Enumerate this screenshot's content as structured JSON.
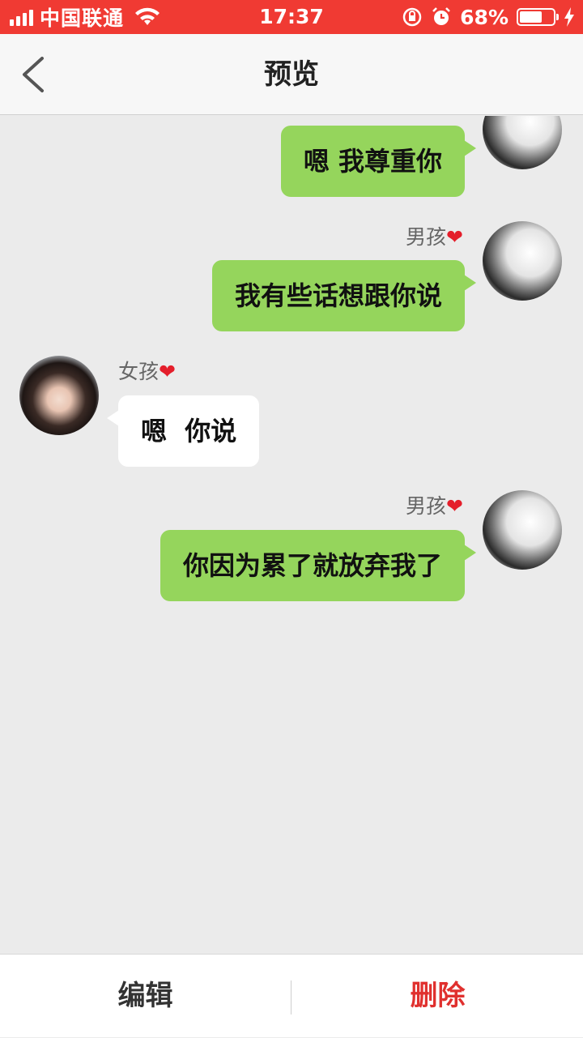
{
  "status_bar": {
    "carrier": "中国联通",
    "time": "17:37",
    "battery_percent": "68%",
    "battery_level": 0.68,
    "icons": [
      "signal-icon",
      "wifi-icon",
      "rotation-lock-icon",
      "alarm-icon",
      "battery-icon",
      "charging-icon"
    ]
  },
  "nav": {
    "title": "预览",
    "back_icon": "chevron-left-icon"
  },
  "messages": [
    {
      "side": "right",
      "sender": "",
      "text": "嗯 我尊重你"
    },
    {
      "side": "right",
      "sender": "男孩",
      "text": "我有些话想跟你说"
    },
    {
      "side": "left",
      "sender": "女孩",
      "text": "嗯  你说"
    },
    {
      "side": "right",
      "sender": "男孩",
      "text": "你因为累了就放弃我了"
    }
  ],
  "heart_glyph": "❤",
  "bottom_bar": {
    "edit_label": "编辑",
    "delete_label": "删除"
  },
  "colors": {
    "status_bar": "#f03a33",
    "bubble_right": "#95d55c",
    "bubble_left": "#ffffff",
    "chat_background": "#ebebeb",
    "delete_text": "#e0302e",
    "heart": "#e41e2b"
  }
}
